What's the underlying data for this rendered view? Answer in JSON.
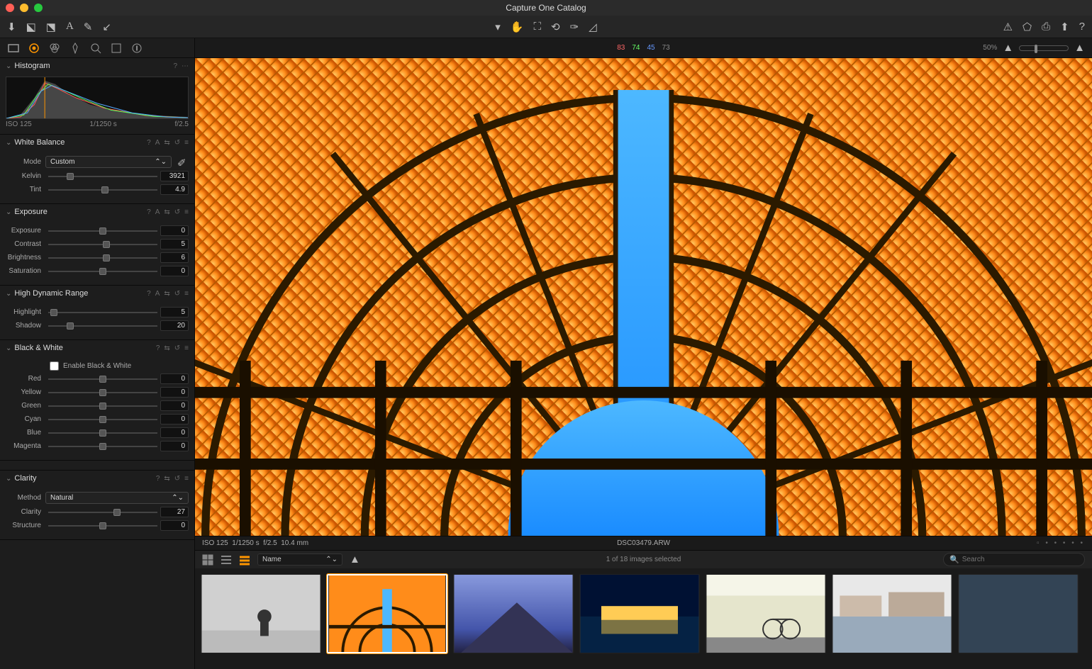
{
  "window": {
    "title": "Capture One Catalog"
  },
  "toolbar": {
    "left_icons": [
      "import-icon",
      "browser-left-icon",
      "browser-right-icon",
      "annotate-icon",
      "brush-icon",
      "erase-icon",
      "undo-icon"
    ],
    "center_icons": [
      "cursor-icon",
      "pan-icon",
      "crop-icon",
      "rotate-icon",
      "picker-icon",
      "mask-icon"
    ],
    "right_icons": [
      "warnings-icon",
      "tag-icon",
      "print-icon",
      "export-icon",
      "help-icon"
    ]
  },
  "tooltabs": [
    "library-icon",
    "lens-icon",
    "color-icon",
    "exposure-icon",
    "detail-icon",
    "adjust-icon",
    "metadata-icon",
    "output-icon"
  ],
  "histogram": {
    "title": "Histogram",
    "iso": "ISO 125",
    "shutter": "1/1250 s",
    "aperture": "f/2.5"
  },
  "white_balance": {
    "title": "White Balance",
    "mode_label": "Mode",
    "mode_value": "Custom",
    "kelvin_label": "Kelvin",
    "kelvin_value": "3921",
    "tint_label": "Tint",
    "tint_value": "4.9"
  },
  "exposure": {
    "title": "Exposure",
    "exposure_label": "Exposure",
    "exposure_value": "0",
    "contrast_label": "Contrast",
    "contrast_value": "5",
    "brightness_label": "Brightness",
    "brightness_value": "6",
    "saturation_label": "Saturation",
    "saturation_value": "0"
  },
  "hdr": {
    "title": "High Dynamic Range",
    "highlight_label": "Highlight",
    "highlight_value": "5",
    "shadow_label": "Shadow",
    "shadow_value": "20"
  },
  "bw": {
    "title": "Black & White",
    "enable_label": "Enable Black & White",
    "red_label": "Red",
    "red_value": "0",
    "yellow_label": "Yellow",
    "yellow_value": "0",
    "green_label": "Green",
    "green_value": "0",
    "cyan_label": "Cyan",
    "cyan_value": "0",
    "blue_label": "Blue",
    "blue_value": "0",
    "magenta_label": "Magenta",
    "magenta_value": "0"
  },
  "clarity": {
    "title": "Clarity",
    "method_label": "Method",
    "method_value": "Natural",
    "clarity_label": "Clarity",
    "clarity_value": "27",
    "structure_label": "Structure",
    "structure_value": "0"
  },
  "readout": {
    "r": "83",
    "g": "74",
    "b": "45",
    "l": "73"
  },
  "zoom": {
    "percent": "50%"
  },
  "image_info": {
    "iso": "ISO 125",
    "shutter": "1/1250 s",
    "aperture": "f/2.5",
    "focal": "10.4 mm",
    "filename": "DSC03479.ARW"
  },
  "browser": {
    "sort_label": "Name",
    "selection": "1 of 18 images selected",
    "search_placeholder": "Search"
  },
  "panel_actions": {
    "help": "?",
    "auto": "A",
    "copy": "⇆",
    "reset": "↺",
    "menu": "≡"
  }
}
